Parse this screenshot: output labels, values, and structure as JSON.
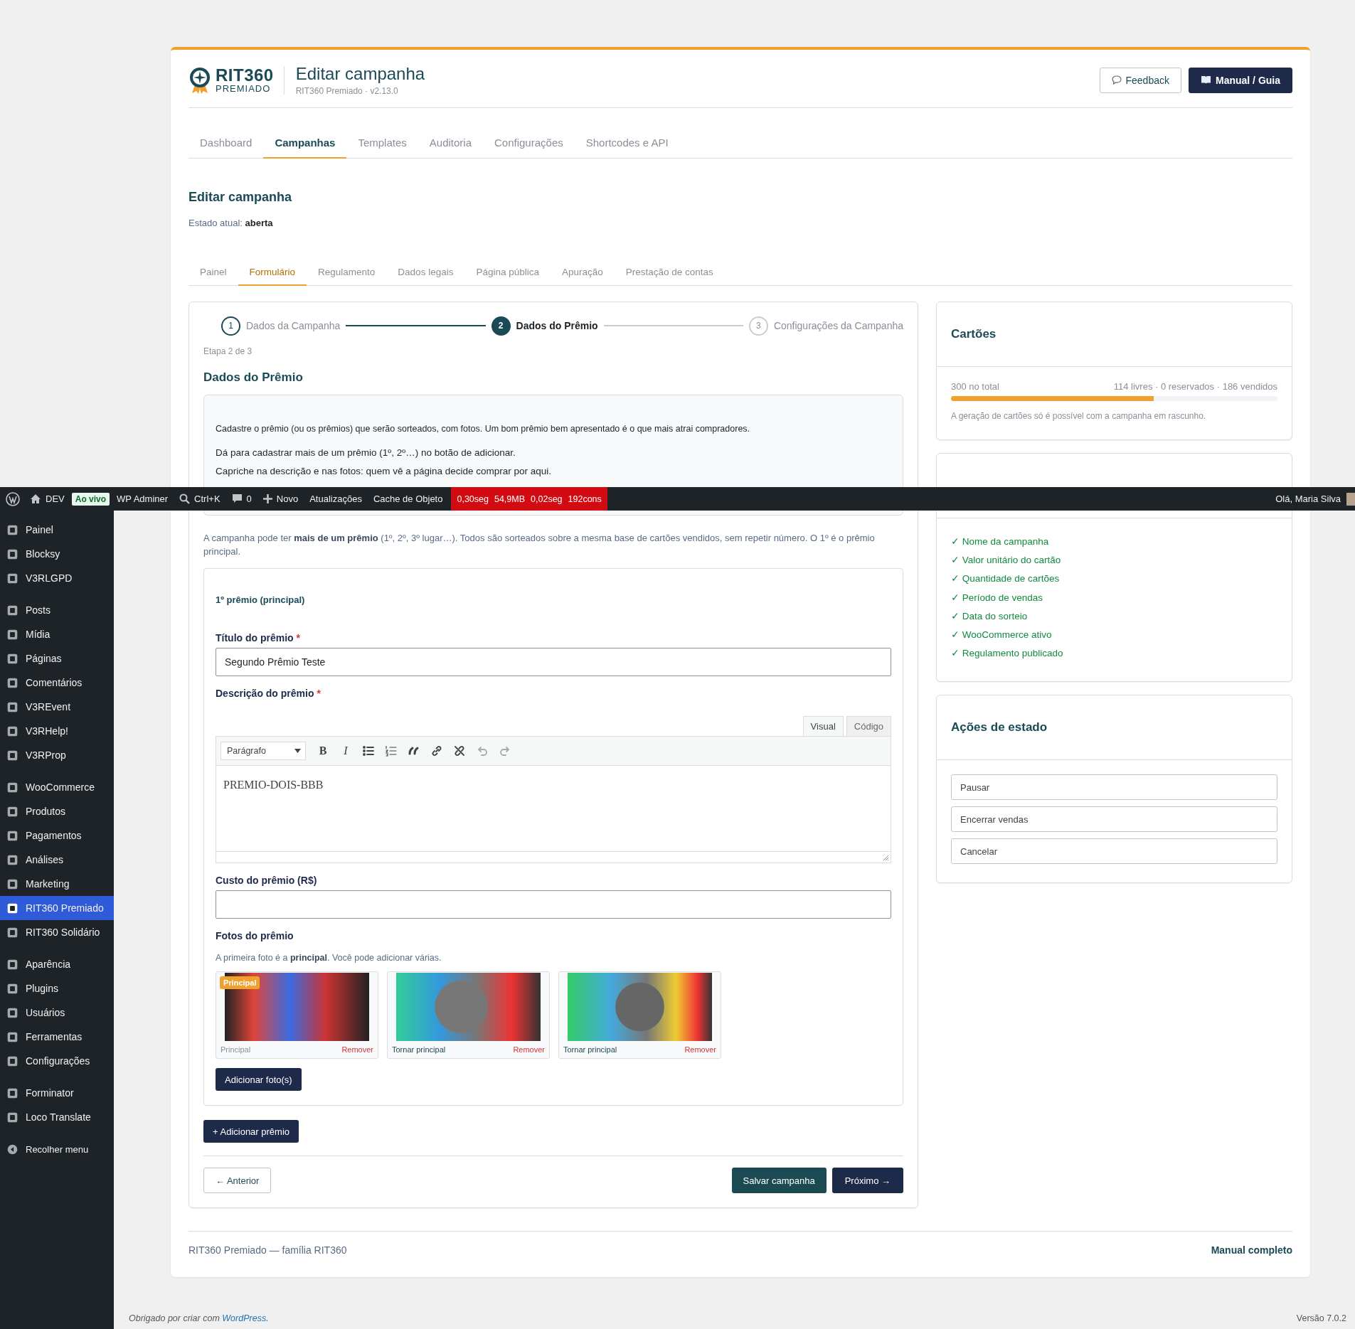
{
  "admin_bar": {
    "items": [
      {
        "kind": "site",
        "label": "DEV"
      },
      {
        "kind": "badge",
        "label": "Ao vivo"
      },
      {
        "kind": "link",
        "label": "WP Adminer"
      },
      {
        "kind": "search",
        "label": "Ctrl+K"
      },
      {
        "kind": "comments",
        "label": "0"
      },
      {
        "kind": "new",
        "label": "Novo"
      },
      {
        "kind": "link",
        "label": "Atualizações"
      },
      {
        "kind": "link",
        "label": "Cache de Objeto"
      }
    ],
    "stats": [
      "0,30seg",
      "54,9MB",
      "0,02seg",
      "192cons"
    ],
    "greeting": "Olá, Maria Silva"
  },
  "sidebar": {
    "groups": [
      [
        {
          "label": "Painel",
          "selected": false
        },
        {
          "label": "Blocksy",
          "selected": false
        },
        {
          "label": "V3RLGPD",
          "selected": false
        }
      ],
      [
        {
          "label": "Posts",
          "selected": false
        },
        {
          "label": "Mídia",
          "selected": false
        },
        {
          "label": "Páginas",
          "selected": false
        },
        {
          "label": "Comentários",
          "selected": false
        },
        {
          "label": "V3REvent",
          "selected": false
        },
        {
          "label": "V3RHelp!",
          "selected": false
        },
        {
          "label": "V3RProp",
          "selected": false
        }
      ],
      [
        {
          "label": "WooCommerce",
          "selected": false
        },
        {
          "label": "Produtos",
          "selected": false
        },
        {
          "label": "Pagamentos",
          "selected": false
        },
        {
          "label": "Análises",
          "selected": false
        },
        {
          "label": "Marketing",
          "selected": false
        },
        {
          "label": "RIT360 Premiado",
          "selected": true
        },
        {
          "label": "RIT360 Solidário",
          "selected": false
        }
      ],
      [
        {
          "label": "Aparência",
          "selected": false
        },
        {
          "label": "Plugins",
          "selected": false
        },
        {
          "label": "Usuários",
          "selected": false
        },
        {
          "label": "Ferramentas",
          "selected": false
        },
        {
          "label": "Configurações",
          "selected": false
        }
      ],
      [
        {
          "label": "Forminator",
          "selected": false
        },
        {
          "label": "Loco Translate",
          "selected": false
        }
      ]
    ],
    "collapse": "Recolher menu"
  },
  "header": {
    "brand": "RIT360",
    "brand_sub": "PREMIADO",
    "title": "Editar campanha",
    "subtitle": "RIT360 Premiado · v2.13.0",
    "buttons": [
      {
        "label": "Feedback",
        "kind": "secondary"
      },
      {
        "label": "Manual / Guia",
        "kind": "primary"
      }
    ]
  },
  "nav_tabs": [
    {
      "label": "Dashboard",
      "selected": false
    },
    {
      "label": "Campanhas",
      "selected": true
    },
    {
      "label": "Templates",
      "selected": false
    },
    {
      "label": "Auditoria",
      "selected": false
    },
    {
      "label": "Configurações",
      "selected": false
    },
    {
      "label": "Shortcodes e API",
      "selected": false
    }
  ],
  "page": {
    "heading": "Editar campanha",
    "status_label": "Estado atual:",
    "status_value": "aberta"
  },
  "sub_tabs": [
    {
      "label": "Painel",
      "selected": false
    },
    {
      "label": "Formulário",
      "selected": true
    },
    {
      "label": "Regulamento",
      "selected": false
    },
    {
      "label": "Dados legais",
      "selected": false
    },
    {
      "label": "Página pública",
      "selected": false
    },
    {
      "label": "Apuração",
      "selected": false
    },
    {
      "label": "Prestação de contas",
      "selected": false
    }
  ],
  "stepper": {
    "steps": [
      {
        "number": "1",
        "label": "Dados da Campanha",
        "done": true,
        "current": false
      },
      {
        "number": "2",
        "label": "Dados do Prêmio",
        "done": false,
        "current": true
      },
      {
        "number": "3",
        "label": "Configurações da Campanha",
        "done": false,
        "current": false
      }
    ],
    "caption": "Etapa 2 de 3"
  },
  "section_title": "Dados do Prêmio",
  "info_box": {
    "lines": [
      "Cadastre o prêmio (ou os prêmios) que serão sorteados, com fotos. Um bom prêmio bem apresentado é o que mais atrai compradores.",
      "Dá para cadastrar mais de um prêmio (1º, 2º…) no botão de adicionar.",
      "Capriche na descrição e nas fotos: quem vê a página decide comprar por aqui."
    ]
  },
  "multi_prize_note": "A campanha pode ter **mais de um prêmio** (1º, 2º, 3º lugar…). Todos são sorteados sobre a mesma base de cartões vendidos, sem repetir número. O 1º é o prêmio principal.",
  "prize": {
    "heading": "1º prêmio (principal)",
    "title_field": {
      "label": "Título do prêmio",
      "required_mark": "*",
      "value": "Segundo Prêmio Teste"
    },
    "description_field": {
      "label": "Descrição do prêmio",
      "required_mark": "*",
      "editor_tabs": [
        {
          "label": "Visual",
          "selected": true
        },
        {
          "label": "Código",
          "selected": false
        }
      ],
      "format": "Parágrafo",
      "tools": [
        {
          "kind": "bold",
          "glyph": "B",
          "disabled": false
        },
        {
          "kind": "italic",
          "glyph": "I",
          "disabled": false
        },
        {
          "kind": "bullets",
          "disabled": false
        },
        {
          "kind": "numbers",
          "disabled": false
        },
        {
          "kind": "quote",
          "disabled": false
        },
        {
          "kind": "link",
          "disabled": false
        },
        {
          "kind": "unlink",
          "disabled": false
        },
        {
          "kind": "undo",
          "disabled": true
        },
        {
          "kind": "redo",
          "disabled": true
        }
      ],
      "content": "PREMIO-DOIS-BBB"
    },
    "cost_field": {
      "label": "Custo do prêmio (R$)"
    },
    "photos": {
      "label": "Fotos do prêmio",
      "hint": "A primeira foto é a **principal**. Você pode adicionar várias.",
      "items": [
        {
          "badge": "Principal",
          "action": "Principal",
          "primary": true,
          "remove": "Remover"
        },
        {
          "action": "Tornar principal",
          "primary": false,
          "remove": "Remover"
        },
        {
          "action": "Tornar principal",
          "primary": false,
          "remove": "Remover"
        }
      ],
      "add_button": "Adicionar foto(s)"
    }
  },
  "add_prize_button": "+ Adicionar prêmio",
  "form_buttons": {
    "back": "← Anterior",
    "save": "Salvar campanha",
    "next": "Próximo →"
  },
  "cards": {
    "tickets": {
      "title": "Cartões",
      "total": "300 no total",
      "breakdown": "114 livres · 0 reservados · 186 vendidos",
      "level": 0.62,
      "note": "A geração de cartões só é possível com a campanha em rascunho."
    },
    "checklist": {
      "items": [
        {
          "mark": "✓",
          "label": "Nome da campanha",
          "done": true
        },
        {
          "mark": "✓",
          "label": "Valor unitário do cartão",
          "done": true
        },
        {
          "mark": "✓",
          "label": "Quantidade de cartões",
          "done": true
        },
        {
          "mark": "✓",
          "label": "Período de vendas",
          "done": true
        },
        {
          "mark": "✓",
          "label": "Data do sorteio",
          "done": true
        },
        {
          "mark": "✓",
          "label": "WooCommerce ativo",
          "done": true
        },
        {
          "mark": "✓",
          "label": "Regulamento publicado",
          "done": true
        }
      ]
    },
    "actions": {
      "title": "Ações de estado",
      "buttons": [
        "Pausar",
        "Encerrar vendas",
        "Cancelar"
      ]
    }
  },
  "card_footer": {
    "text": "RIT360 Premiado — família RIT360",
    "link": "Manual completo"
  },
  "wp_footer": {
    "before": "Obrigado por criar com ",
    "link": "WordPress",
    "after": ".",
    "version": "Versão 7.0.2"
  }
}
